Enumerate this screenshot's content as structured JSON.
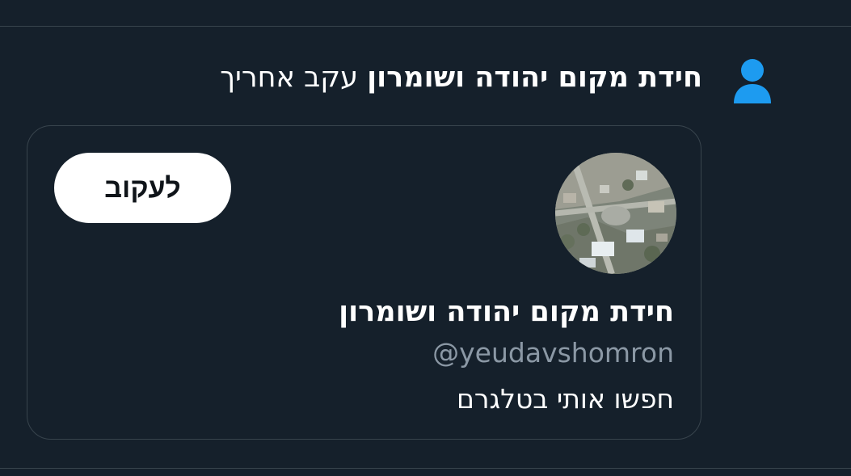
{
  "notification": {
    "icon": "person-icon",
    "icon_color": "#1d9bf0",
    "account_name": "חידת מקום יהודה ושומרון",
    "action_text": "עקב אחריך"
  },
  "card": {
    "follow_button_label": "לעקוב",
    "avatar": "aerial-village-photo",
    "display_name": "חידת מקום יהודה ושומרון",
    "handle": "@yeudavshomron",
    "bio": "חפשו אותי בטלגרם"
  },
  "colors": {
    "background": "#15202b",
    "border": "#38444d",
    "text_primary": "#ffffff",
    "text_secondary": "#8b98a5",
    "accent": "#1d9bf0"
  }
}
